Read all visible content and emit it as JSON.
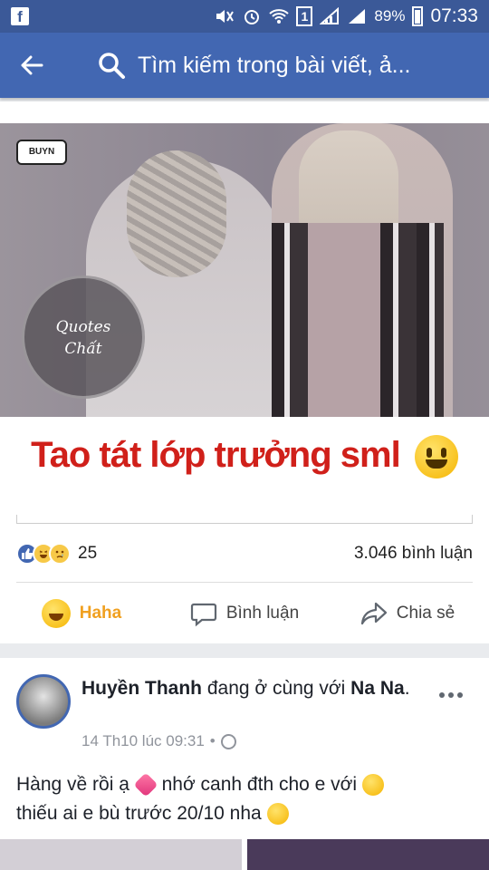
{
  "status_bar": {
    "battery": "89%",
    "time": "07:33",
    "sim": "1"
  },
  "top_bar": {
    "search_placeholder": "Tìm kiếm trong bài viết, ả..."
  },
  "post1": {
    "image_watermark": "BUYN",
    "image_badge_line1": "Quotes",
    "image_badge_line2": "Chất",
    "headline": "Tao tát lớp trưởng sml",
    "reaction_count": "25",
    "comment_count": "3.046 bình luận",
    "actions": {
      "haha": "Haha",
      "comment": "Bình luận",
      "share": "Chia sẻ"
    }
  },
  "post2": {
    "author": "Huyền Thanh",
    "with_text": "đang ở cùng với",
    "tagged": "Na Na",
    "tagged_suffix": ".",
    "timestamp": "14 Th10 lúc 09:31",
    "separator": "•",
    "text_part1": "Hàng về rồi ạ",
    "text_part2": "nhớ canh đth cho e với",
    "text_part3": "thiếu ai e bù trước 20/10 nha"
  }
}
